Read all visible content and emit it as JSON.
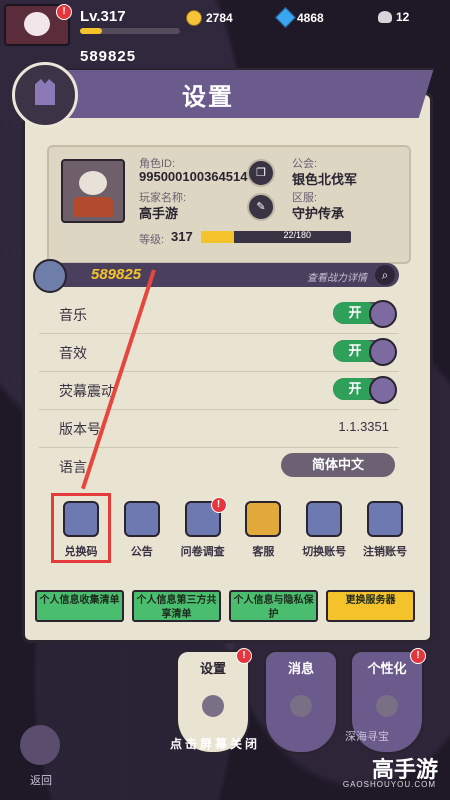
{
  "hud": {
    "level": "Lv.317",
    "gold": "2784",
    "gems": "4868",
    "skulls": "12",
    "power": "589825"
  },
  "title": "设置",
  "profile": {
    "role_id_label": "角色ID:",
    "role_id": "995000100364514",
    "name_label": "玩家名称:",
    "name": "高手游",
    "guild_label": "公会:",
    "guild": "银色北伐军",
    "server_label": "区服:",
    "server": "守护传承",
    "level_label": "等级:",
    "level": "317",
    "exp": "22/180",
    "exp_fraction": 0.12
  },
  "power": {
    "value": "589825",
    "detail_link": "查看战力详情"
  },
  "settings": [
    {
      "label": "音乐",
      "toggle": "开"
    },
    {
      "label": "音效",
      "toggle": "开"
    },
    {
      "label": "荧幕震动",
      "toggle": "开"
    }
  ],
  "version": {
    "label": "版本号",
    "value": "1.1.3351"
  },
  "language": {
    "label": "语言",
    "value": "简体中文"
  },
  "icons": [
    {
      "label": "兑换码"
    },
    {
      "label": "公告"
    },
    {
      "label": "问卷调查"
    },
    {
      "label": "客服"
    },
    {
      "label": "切换账号"
    },
    {
      "label": "注销账号"
    }
  ],
  "bottom_buttons": [
    "个人信息收集清单",
    "个人信息第三方共享清单",
    "个人信息与隐私保护",
    "更换服务器"
  ],
  "tabs": [
    "设置",
    "消息",
    "个性化"
  ],
  "close_hint": "点击屏幕关闭",
  "back_label": "返回",
  "treasure_label": "深海寻宝",
  "watermark": {
    "name": "高手游",
    "url": "GAOSHOUYOU.COM"
  },
  "badge": "!"
}
